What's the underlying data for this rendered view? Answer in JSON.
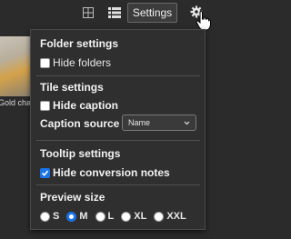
{
  "toolbar": {
    "settings_label": "Settings",
    "icons": [
      "grid-icon",
      "list-icon",
      "gear-icon"
    ]
  },
  "background": {
    "caption": "Gold cha"
  },
  "panel": {
    "folder": {
      "title": "Folder settings",
      "hide_folders": {
        "label": "Hide folders",
        "checked": false
      }
    },
    "tile": {
      "title": "Tile settings",
      "hide_caption": {
        "label": "Hide caption",
        "checked": false
      },
      "caption_source": {
        "label": "Caption source",
        "value": "Name"
      }
    },
    "tooltip": {
      "title": "Tooltip settings",
      "hide_conversion_notes": {
        "label": "Hide conversion notes",
        "checked": true
      }
    },
    "preview": {
      "title": "Preview size",
      "options": [
        "S",
        "M",
        "L",
        "XL",
        "XXL"
      ],
      "selected": "M"
    }
  },
  "colors": {
    "accent": "#1a73e8",
    "panel_bg": "#2f2f2f",
    "page_bg": "#2b2b2b"
  }
}
